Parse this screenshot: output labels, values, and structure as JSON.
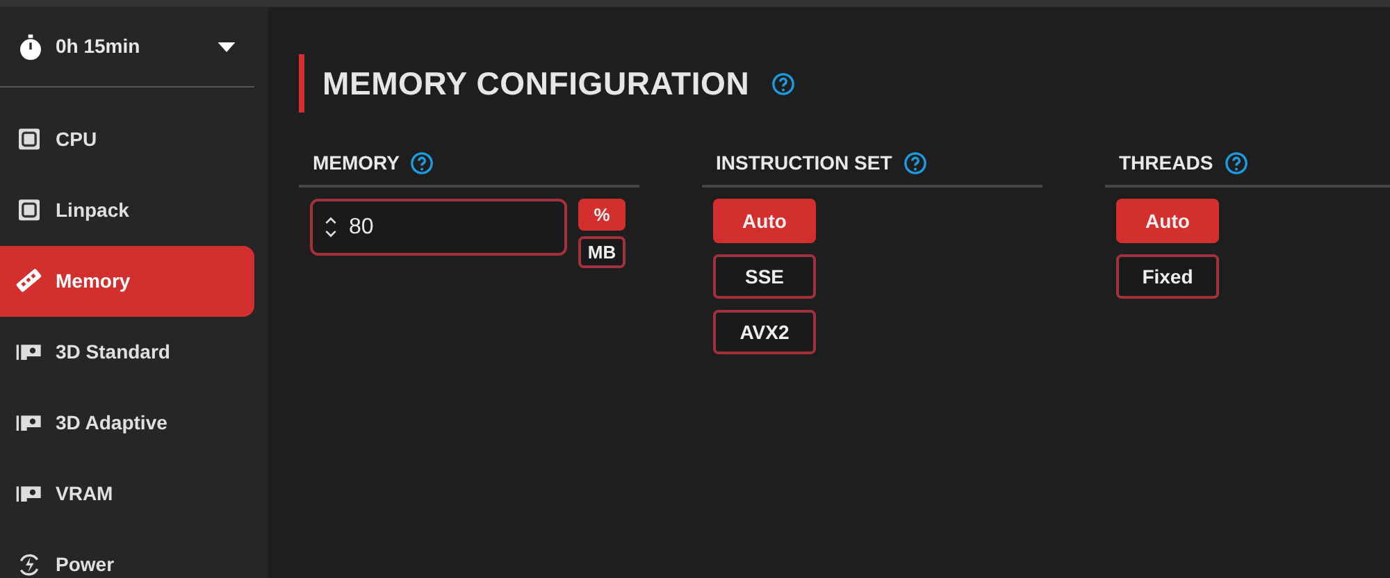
{
  "timer": {
    "label": "0h 15min"
  },
  "sidebar": {
    "items": [
      {
        "label": "CPU",
        "kind": "chip",
        "selected": false
      },
      {
        "label": "Linpack",
        "kind": "chip",
        "selected": false
      },
      {
        "label": "Memory",
        "kind": "ram",
        "selected": true
      },
      {
        "label": "3D Standard",
        "kind": "gpu",
        "selected": false
      },
      {
        "label": "3D Adaptive",
        "kind": "gpu",
        "selected": false
      },
      {
        "label": "VRAM",
        "kind": "gpu",
        "selected": false
      },
      {
        "label": "Power",
        "kind": "power",
        "selected": false
      }
    ]
  },
  "page": {
    "title": "MEMORY CONFIGURATION"
  },
  "sections": [
    {
      "title": "MEMORY",
      "kind": "input",
      "value": "80",
      "units": [
        {
          "label": "%",
          "selected": true
        },
        {
          "label": "MB",
          "selected": false
        }
      ]
    },
    {
      "title": "INSTRUCTION SET",
      "kind": "options",
      "options": [
        {
          "label": "Auto",
          "selected": true
        },
        {
          "label": "SSE",
          "selected": false
        },
        {
          "label": "AVX2",
          "selected": false
        }
      ]
    },
    {
      "title": "THREADS",
      "kind": "options",
      "options": [
        {
          "label": "Auto",
          "selected": true
        },
        {
          "label": "Fixed",
          "selected": false
        }
      ]
    }
  ]
}
